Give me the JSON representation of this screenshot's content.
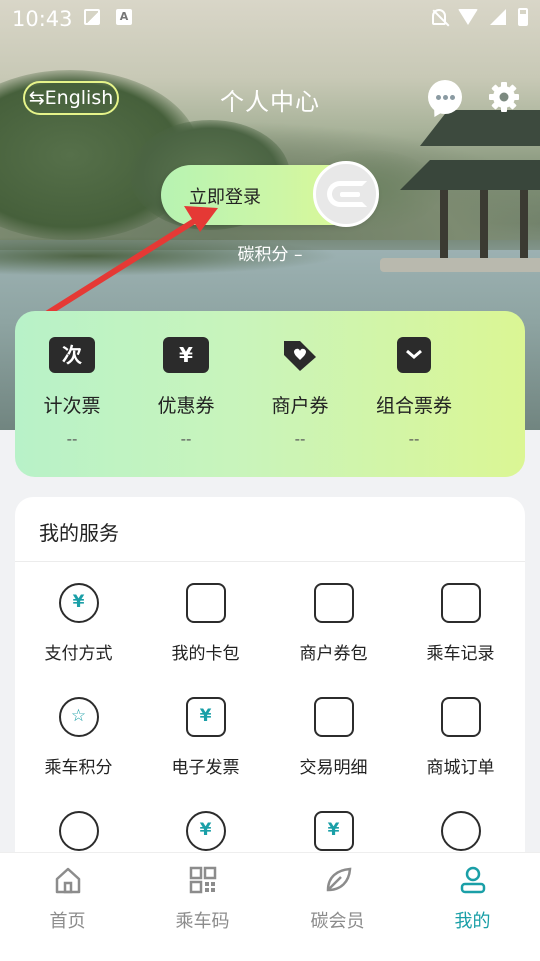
{
  "status_bar": {
    "time": "10:43"
  },
  "header": {
    "language_button": "⇆English",
    "title": "个人中心"
  },
  "login": {
    "button_label": "立即登录",
    "carbon_points": "碳积分 –"
  },
  "tickets": [
    {
      "label": "计次票",
      "value": "--",
      "icon": "ci-ticket-icon",
      "glyph": "次"
    },
    {
      "label": "优惠券",
      "value": "--",
      "icon": "discount-coupon-icon",
      "glyph": "¥"
    },
    {
      "label": "商户券",
      "value": "--",
      "icon": "merchant-tag-icon",
      "glyph": ""
    },
    {
      "label": "组合票券",
      "value": "--",
      "icon": "combo-ticket-icon",
      "glyph": ""
    }
  ],
  "services": {
    "title": "我的服务",
    "items": [
      {
        "label": "支付方式",
        "icon": "payment-icon",
        "glyph": "¥"
      },
      {
        "label": "我的卡包",
        "icon": "wallet-icon",
        "glyph": ""
      },
      {
        "label": "商户券包",
        "icon": "store-icon",
        "glyph": ""
      },
      {
        "label": "乘车记录",
        "icon": "bus-icon",
        "glyph": ""
      },
      {
        "label": "乘车积分",
        "icon": "star-points-icon",
        "glyph": "☆"
      },
      {
        "label": "电子发票",
        "icon": "invoice-icon",
        "glyph": "¥"
      },
      {
        "label": "交易明细",
        "icon": "transaction-detail-icon",
        "glyph": ""
      },
      {
        "label": "商城订单",
        "icon": "shopping-bag-icon",
        "glyph": ""
      },
      {
        "label": "",
        "icon": "location-pin-icon",
        "glyph": ""
      },
      {
        "label": "",
        "icon": "refund-icon",
        "glyph": "¥"
      },
      {
        "label": "",
        "icon": "ticket-yuan-icon",
        "glyph": "¥"
      },
      {
        "label": "",
        "icon": "customer-service-icon",
        "glyph": ""
      }
    ]
  },
  "bottom_nav": [
    {
      "label": "首页",
      "icon": "home-icon",
      "active": false
    },
    {
      "label": "乘车码",
      "icon": "qr-code-icon",
      "active": false
    },
    {
      "label": "碳会员",
      "icon": "leaf-icon",
      "active": false
    },
    {
      "label": "我的",
      "icon": "user-icon",
      "active": true
    }
  ],
  "colors": {
    "accent": "#1a9fa7",
    "pill_start": "#b7f3b2",
    "pill_end": "#e1f98f",
    "arrow": "#e53935"
  }
}
